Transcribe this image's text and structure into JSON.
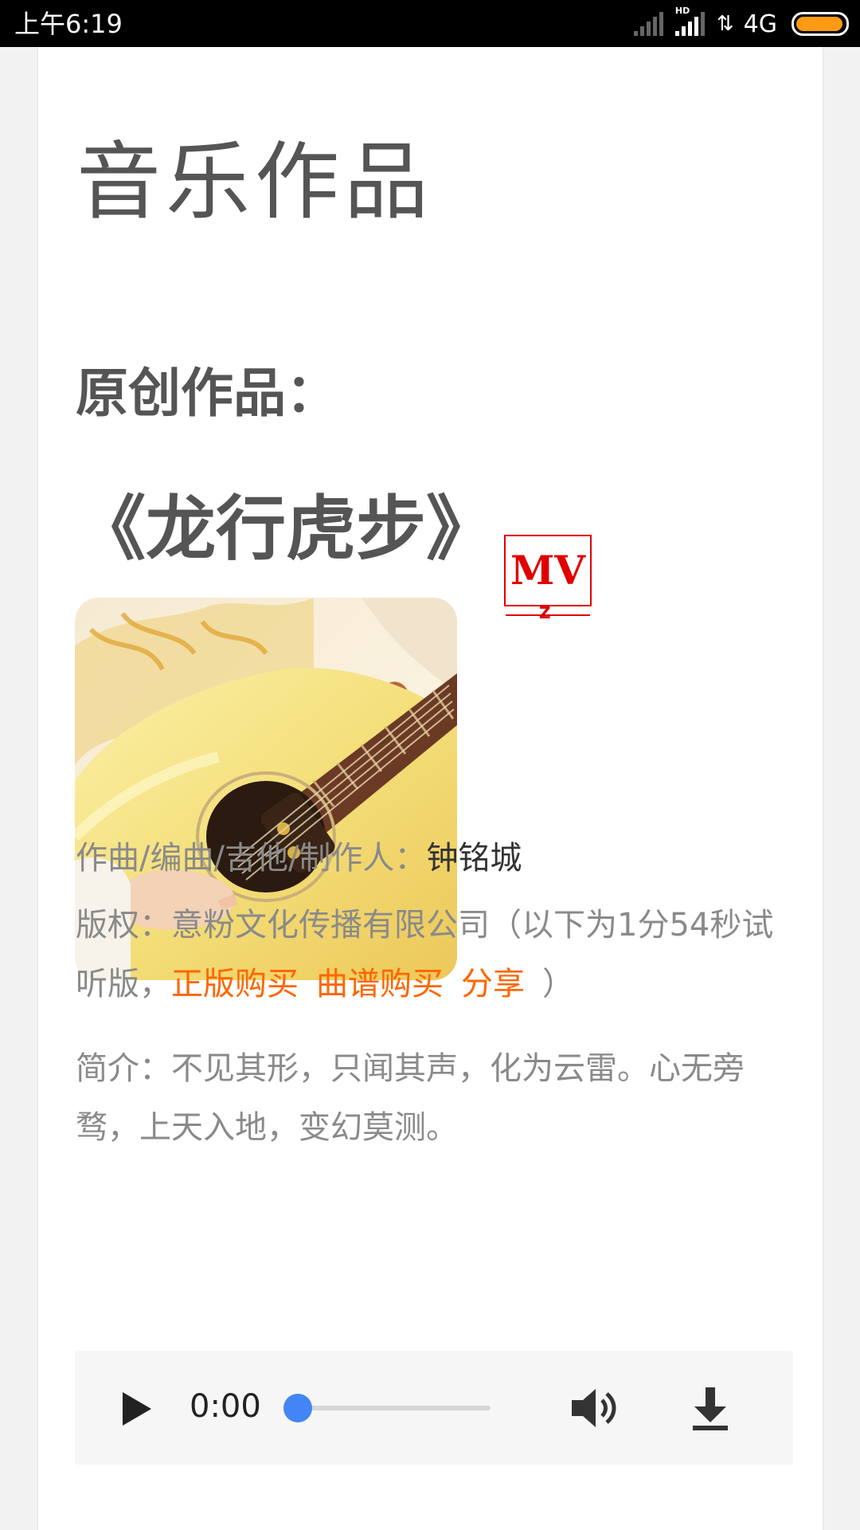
{
  "status_bar": {
    "time": "上午6:19",
    "hd_label": "HD",
    "network": "4G",
    "battery_color": "#ff9a14"
  },
  "page": {
    "title": "音乐作品",
    "section_heading": "原创作品：",
    "song_title": "《龙行虎步》",
    "mv_label": "MV",
    "credits": {
      "label": "作曲/编曲/吉他/制作人：",
      "value": "钟铭城"
    },
    "copyright": {
      "prefix": "版权：意粉文化传播有限公司（以下为1分54秒试听版，",
      "links": [
        "正版购买",
        "曲谱购买",
        "分享"
      ],
      "suffix": "）"
    },
    "intro": "简介：不见其形，只闻其声，化为云雷。心无旁骛，上天入地，变幻莫测。"
  },
  "player": {
    "time": "0:00",
    "progress": 0,
    "accent_color": "#4285f4",
    "icons": [
      "play-icon",
      "volume-icon",
      "download-icon"
    ]
  },
  "colors": {
    "link": "#ff6600",
    "mv_red": "#e00000",
    "title_gray": "#555555"
  }
}
